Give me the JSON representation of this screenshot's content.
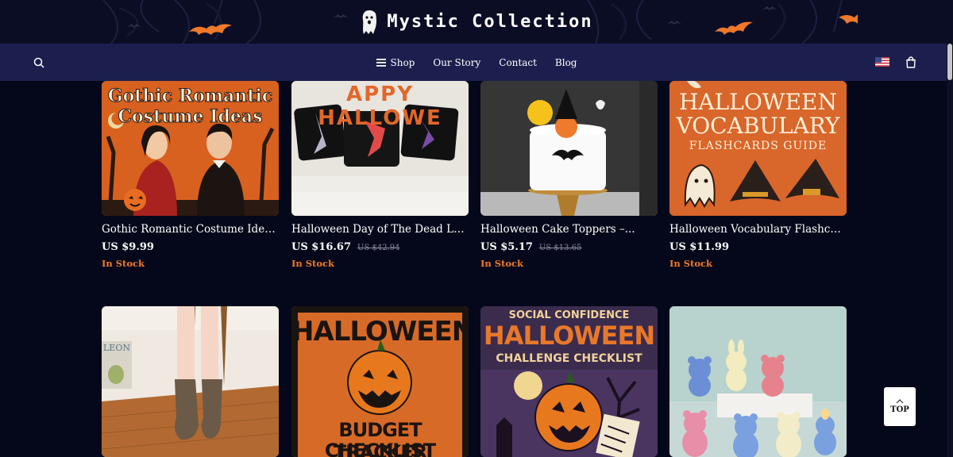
{
  "brand": {
    "title": "Mystic Collection"
  },
  "nav": {
    "links": [
      {
        "label": "Shop",
        "icon": "hamburger-menu-icon"
      },
      {
        "label": "Our Story"
      },
      {
        "label": "Contact"
      },
      {
        "label": "Blog"
      }
    ],
    "search_icon": "search-icon",
    "flag_icon": "us-flag-icon",
    "cart_icon": "shopping-bag-icon"
  },
  "products": [
    {
      "name": "Gothic Romantic Costume Ideas |...",
      "price": "US $9.99",
      "old_price": "",
      "stock": "In Stock",
      "image_text": [
        "Gothic Romantic",
        "Costume Ideas"
      ]
    },
    {
      "name": "Halloween Day of The Dead Lace...",
      "price": "US $16.67",
      "old_price": "US $42.94",
      "stock": "In Stock",
      "image_text": [
        "APPY HALLOWE"
      ]
    },
    {
      "name": "Halloween Cake Toppers –...",
      "price": "US $5.17",
      "old_price": "US $13.65",
      "stock": "In Stock",
      "image_text": []
    },
    {
      "name": "Halloween Vocabulary Flashcard...",
      "price": "US $11.99",
      "old_price": "",
      "stock": "In Stock",
      "image_text": [
        "HALLOWEEN",
        "VOCABULARY",
        "FLASHCARDS GUIDE"
      ]
    },
    {
      "name": "",
      "image_text": [
        "LEON"
      ]
    },
    {
      "name": "",
      "image_text": [
        "HALLOWEEN",
        "BUDGET TRACKER",
        "CHECKLIST"
      ]
    },
    {
      "name": "",
      "image_text": [
        "SOCIAL CONFIDENCE",
        "HALLOWEEN",
        "CHALLENGE CHECKLIST"
      ]
    },
    {
      "name": "",
      "image_text": []
    }
  ],
  "top_button": {
    "label": "TOP",
    "icon": "chevron-up-icon"
  },
  "colors": {
    "background": "#05081a",
    "navbar": "#1c1f4e",
    "stock_orange": "#f07a2c",
    "bat_orange": "#f07a2c"
  }
}
